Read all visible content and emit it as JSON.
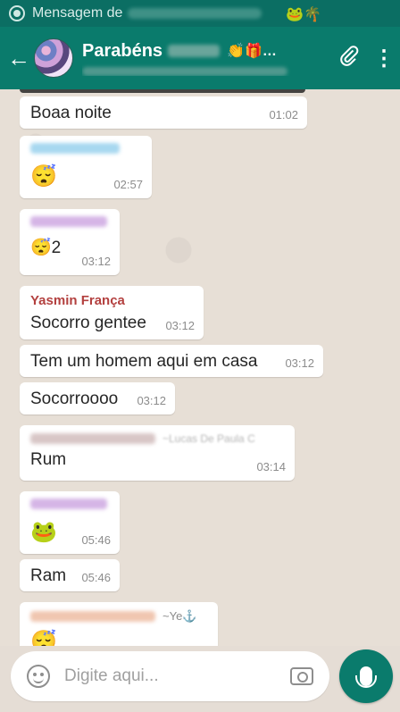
{
  "status_bar": {
    "notification_text": "Mensagem de",
    "emojis": "🐸🌴"
  },
  "header": {
    "back_icon": "arrow-back-icon",
    "group_name": "Parabéns",
    "group_name_deco": "👏🎁…",
    "attach_icon": "paperclip-icon",
    "menu_icon": "more-vertical-icon",
    "colors": {
      "header_bg": "#0a7b6c",
      "status_bg": "#0b6e63"
    }
  },
  "messages": [
    {
      "text": "Boaa noite",
      "time": "01:02"
    },
    {
      "text": "😴",
      "time": "02:57"
    },
    {
      "sender": "",
      "text": "😴2",
      "time": "03:12"
    },
    {
      "sender": "Yasmin França",
      "sender_color": "#b3403f",
      "text": "Socorro gentee",
      "time": "03:12"
    },
    {
      "text": "Tem um homem aqui em casa",
      "time": "03:12"
    },
    {
      "text": "Socorroooo",
      "time": "03:12"
    },
    {
      "sender_suffix": "~Lucas De Paula C",
      "text": "Rum",
      "time": "03:14"
    },
    {
      "text": "🐸",
      "time": "05:46"
    },
    {
      "text": "Ram",
      "time": "05:46"
    },
    {
      "sender_suffix": "~Ye⚓",
      "text": "😴"
    }
  ],
  "input": {
    "placeholder": "Digite aqui...",
    "emoji_icon": "smiley-icon",
    "camera_icon": "camera-icon",
    "mic_icon": "mic-icon"
  }
}
